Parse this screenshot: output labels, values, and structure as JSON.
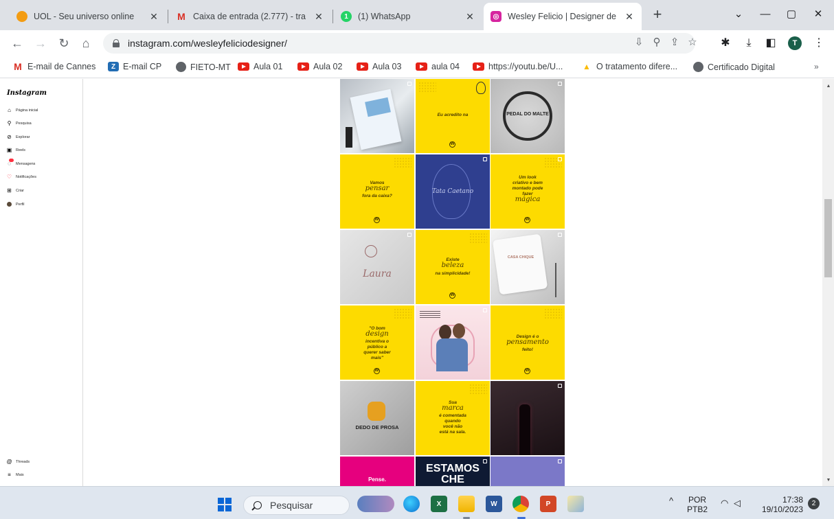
{
  "tabs": [
    {
      "title": "UOL - Seu universo online",
      "icon": "uol-icon"
    },
    {
      "title": "Caixa de entrada (2.777) - tra",
      "icon": "gmail-icon"
    },
    {
      "title": "(1) WhatsApp",
      "icon": "whatsapp-icon"
    },
    {
      "title": "Wesley Felicio | Designer de",
      "icon": "instagram-icon"
    }
  ],
  "window_controls": {
    "dropdown": "⌄",
    "minimize": "—",
    "maximize": "▢",
    "close": "✕"
  },
  "toolbar": {
    "url": "instagram.com/wesleyfeliciodesigner/",
    "profile_initial": "T"
  },
  "bookmarks": [
    {
      "label": "E-mail de Cannes",
      "icon": "gmail-icon"
    },
    {
      "label": "E-mail CP",
      "icon": "zoho-icon"
    },
    {
      "label": "FIETO-MT",
      "icon": "globe-icon"
    },
    {
      "label": "Aula 01",
      "icon": "youtube-icon"
    },
    {
      "label": "Aula 02",
      "icon": "youtube-icon"
    },
    {
      "label": "Aula 03",
      "icon": "youtube-icon"
    },
    {
      "label": "aula 04",
      "icon": "youtube-icon"
    },
    {
      "label": "https://youtu.be/U...",
      "icon": "youtube-icon"
    },
    {
      "label": "O tratamento difere...",
      "icon": "drive-icon"
    },
    {
      "label": "Certificado Digital",
      "icon": "globe-icon"
    }
  ],
  "instagram": {
    "logo": "Instagram",
    "nav": [
      {
        "label": "Página inicial",
        "icon": "home-icon"
      },
      {
        "label": "Pesquisa",
        "icon": "search-icon"
      },
      {
        "label": "Explorar",
        "icon": "compass-icon"
      },
      {
        "label": "Reels",
        "icon": "reels-icon"
      },
      {
        "label": "Mensagens",
        "icon": "messenger-icon"
      },
      {
        "label": "Notificações",
        "icon": "heart-icon"
      },
      {
        "label": "Criar",
        "icon": "plus-square-icon"
      },
      {
        "label": "Perfil",
        "icon": "avatar-icon"
      }
    ],
    "bottom_nav": [
      {
        "label": "Threads",
        "icon": "threads-icon"
      },
      {
        "label": "Mais",
        "icon": "menu-icon"
      }
    ],
    "posts": {
      "p2": "Eu acredito na",
      "p3": "PEDAL DO MALTE",
      "p4a": "Vamos",
      "p4b": "pensar",
      "p4c": "fora da caixa?",
      "p5": "Tata Caetano",
      "p6a": "Um look criativo e bem montado pode fazer",
      "p6b": "mágica",
      "p7": "Laura",
      "p8a": "Existe",
      "p8b": "beleza",
      "p8c": "na simplicidade!",
      "p9": "CASA CHIQUE",
      "p10a": "\"O bom",
      "p10b": "design",
      "p10c": "incentiva o público a querer saber mais\"",
      "p12a": "Design é o",
      "p12b": "pensamento",
      "p12c": "feito!",
      "p13": "DEDO DE PROSA",
      "p14a": "Sua",
      "p14b": "marca",
      "p14c": "é comentada quando você não está na sala.",
      "p16": "Pense.",
      "p17": "ESTAMOS CHE"
    }
  },
  "taskbar": {
    "search_placeholder": "Pesquisar",
    "lang_1": "POR",
    "lang_2": "PTB2",
    "time": "17:38",
    "date": "19/10/2023",
    "notifications": "2"
  }
}
